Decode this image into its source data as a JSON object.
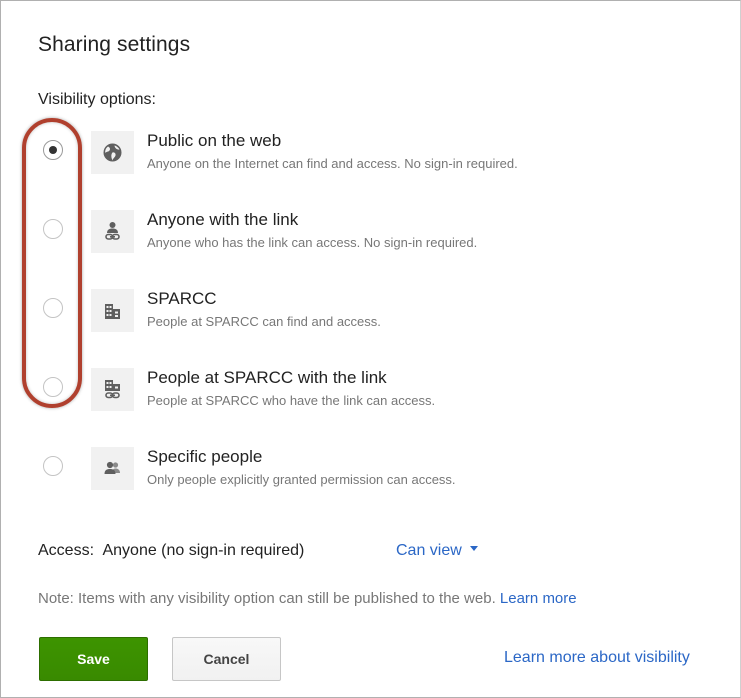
{
  "dialog": {
    "title": "Sharing settings",
    "section_label": "Visibility options:"
  },
  "options": [
    {
      "title": "Public on the web",
      "description": "Anyone on the Internet can find and access. No sign-in required.",
      "icon": "globe-icon",
      "selected": true
    },
    {
      "title": "Anyone with the link",
      "description": "Anyone who has the link can access. No sign-in required.",
      "icon": "person-link-icon",
      "selected": false
    },
    {
      "title": "SPARCC",
      "description": "People at SPARCC can find and access.",
      "icon": "building-icon",
      "selected": false
    },
    {
      "title": "People at SPARCC with the link",
      "description": "People at SPARCC who have the link can access.",
      "icon": "building-link-icon",
      "selected": false
    },
    {
      "title": "Specific people",
      "description": "Only people explicitly granted permission can access.",
      "icon": "people-icon",
      "selected": false
    }
  ],
  "access": {
    "label": "Access:",
    "value": "Anyone (no sign-in required)",
    "permission": "Can view"
  },
  "note": {
    "text": "Note: Items with any visibility option can still be published to the web.",
    "link": "Learn more"
  },
  "footer": {
    "save_label": "Save",
    "cancel_label": "Cancel",
    "learn_more_visibility": "Learn more about visibility"
  },
  "colors": {
    "accent_link": "#2b67c6",
    "save_button": "#3d9400",
    "highlight_annotation": "#b0402e"
  }
}
